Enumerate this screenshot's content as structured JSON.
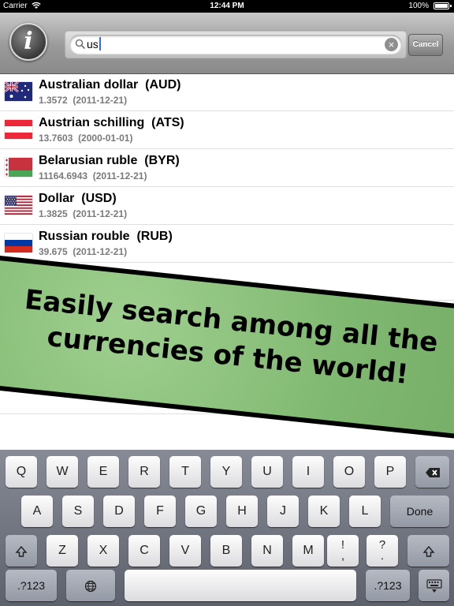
{
  "status_bar": {
    "carrier": "Carrier",
    "time": "12:44 PM",
    "battery": "100%"
  },
  "toolbar": {
    "info_label": "i",
    "search_value": "us",
    "cancel_label": "Cancel"
  },
  "currencies": [
    {
      "name": "Australian dollar  (AUD)",
      "rate": "1.3572",
      "date": "(2011-12-21)",
      "flag": "australia-flag"
    },
    {
      "name": "Austrian schilling  (ATS)",
      "rate": "13.7603",
      "date": "(2000-01-01)",
      "flag": "austria-flag"
    },
    {
      "name": "Belarusian ruble  (BYR)",
      "rate": "11164.6943",
      "date": "(2011-12-21)",
      "flag": "belarus-flag"
    },
    {
      "name": "Dollar  (USD)",
      "rate": "1.3825",
      "date": "(2011-12-21)",
      "flag": "usa-flag"
    },
    {
      "name": "Russian rouble  (RUB)",
      "rate": "39.675",
      "date": "(2011-12-21)",
      "flag": "russia-flag"
    }
  ],
  "banner": {
    "line1": "Easily search among all the",
    "line2": "currencies of the world!"
  },
  "keyboard": {
    "row1": [
      "Q",
      "W",
      "E",
      "R",
      "T",
      "Y",
      "U",
      "I",
      "O",
      "P"
    ],
    "row2": [
      "A",
      "S",
      "D",
      "F",
      "G",
      "H",
      "J",
      "K",
      "L"
    ],
    "done": "Done",
    "row3": [
      "Z",
      "X",
      "C",
      "V",
      "B",
      "N",
      "M"
    ],
    "excl": "!",
    "comma": ",",
    "quest": "?",
    "period": ".",
    "num_label": ".?123"
  },
  "colors": {
    "banner_green": "#7fb870",
    "toolbar_gray": "#9a9a9a",
    "caret_blue": "#2f6ee0"
  }
}
